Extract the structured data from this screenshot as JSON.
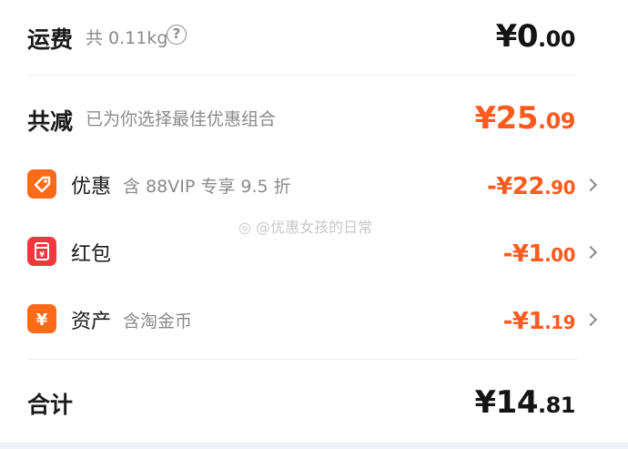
{
  "shipping": {
    "label": "运费",
    "detail": "共 0.11kg",
    "help_icon": "help-circle-icon",
    "amount_currency": "¥",
    "amount_int": "0",
    "amount_dec": ".00"
  },
  "reduction": {
    "label": "共减",
    "detail": "已为你选择最佳优惠组合",
    "amount_currency": "¥",
    "amount_int": "25",
    "amount_dec": ".09"
  },
  "items": [
    {
      "icon": "tag-icon",
      "label": "优惠",
      "detail": "含 88VIP 专享 9.5 折",
      "amount_prefix": "-¥",
      "amount_int": "22",
      "amount_dec": ".90"
    },
    {
      "icon": "red-packet-icon",
      "label": "红包",
      "detail": "",
      "amount_prefix": "-¥",
      "amount_int": "1",
      "amount_dec": ".00"
    },
    {
      "icon": "yuan-coin-icon",
      "label": "资产",
      "detail": "含淘金币",
      "amount_prefix": "-¥",
      "amount_int": "1",
      "amount_dec": ".19"
    }
  ],
  "total": {
    "label": "合计",
    "amount_currency": "¥",
    "amount_int": "14",
    "amount_dec": ".81"
  },
  "watermark": "@优惠女孩的日常",
  "colors": {
    "accent_orange": "#ff5a1f",
    "icon_red": "#f2383f",
    "icon_orange": "#ff6a1a",
    "muted_text": "#8a8a8a"
  }
}
